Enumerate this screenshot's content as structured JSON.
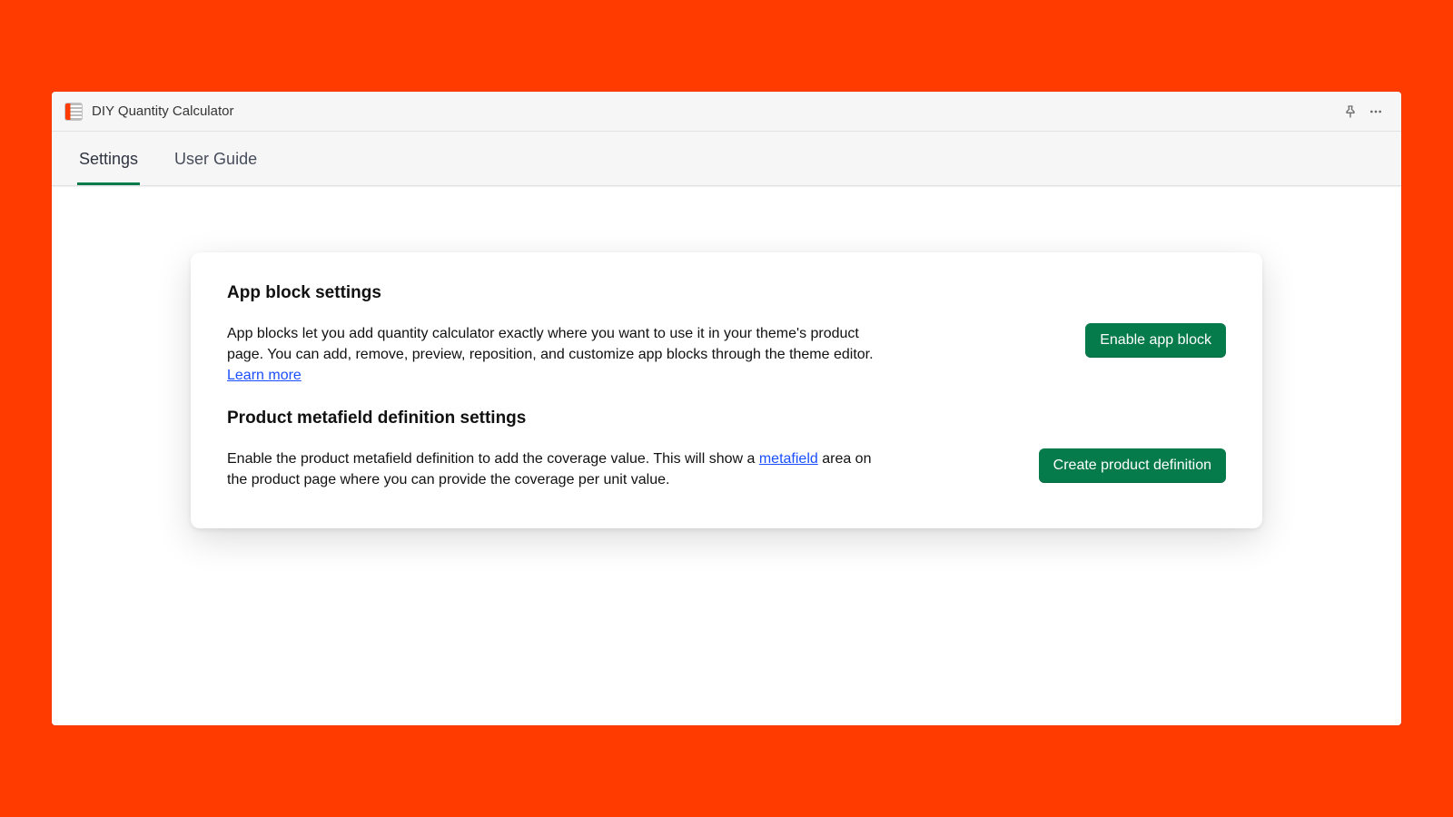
{
  "header": {
    "app_title": "DIY Quantity Calculator"
  },
  "tabs": {
    "settings": "Settings",
    "user_guide": "User Guide",
    "active_index": 0
  },
  "sections": {
    "app_block": {
      "title": "App block settings",
      "desc_before": "App blocks let you add quantity calculator exactly where you want to use it in your theme's product page. You can add, remove, preview, reposition, and customize app blocks through the theme editor. ",
      "link_text": "Learn more",
      "desc_after": "",
      "button_label": "Enable app block"
    },
    "metafield": {
      "title": "Product metafield definition settings",
      "desc_before": "Enable the product metafield definition to add the coverage value. This will show a ",
      "link_text": "metafield",
      "desc_after": " area on the product page where you can provide the coverage per unit value.",
      "button_label": "Create product definition"
    }
  },
  "colors": {
    "background": "#ff3b00",
    "primary_button": "#057a4a",
    "tab_active_underline": "#057a4a",
    "link": "#1a4eff"
  }
}
